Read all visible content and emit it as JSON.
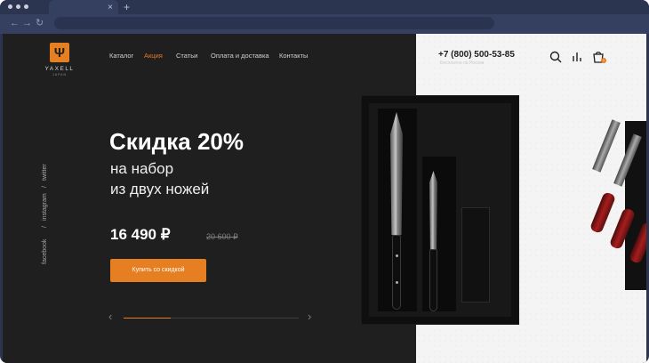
{
  "browser": {
    "tab_close": "×",
    "new_tab": "+",
    "back": "←",
    "forward": "→",
    "reload": "↻"
  },
  "brand": {
    "logo_glyph": "Ψ",
    "name": "YAXELL",
    "sub": "JAPAN",
    "accent": "#e67e22"
  },
  "menu": [
    {
      "label": "Каталог",
      "active": false
    },
    {
      "label": "Акция",
      "active": true
    },
    {
      "label": "Статьи",
      "active": false
    },
    {
      "label": "Оплата и доставка",
      "active": false
    },
    {
      "label": "Контакты",
      "active": false
    }
  ],
  "contact": {
    "phone": "+7 (800) 500-53-85",
    "phone_note": "Бесплатно по России"
  },
  "icons": [
    "search-icon",
    "compare-icon",
    "cart-icon"
  ],
  "cart_count": "1",
  "social": [
    "facebook",
    "/",
    "instagram",
    "/",
    "twitter"
  ],
  "hero": {
    "headline": "Скидка 20%",
    "sub_line_1": "на набор",
    "sub_line_2": "из двух ножей",
    "price": "16 490 ₽",
    "old_price": "20 600 ₽",
    "cta": "Купить со скидкой",
    "prev": "‹",
    "next": "›",
    "progress": 0.27
  }
}
